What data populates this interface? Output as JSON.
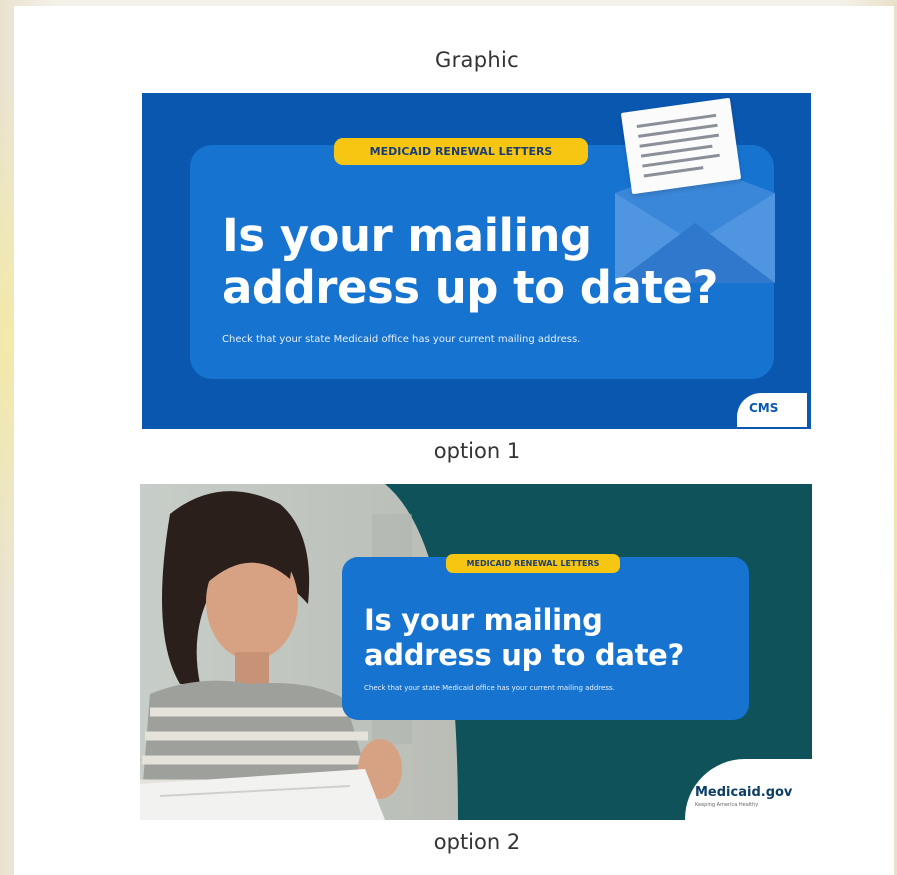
{
  "heading": "Graphic",
  "option1": {
    "caption": "option 1",
    "pill": "MEDICAID RENEWAL LETTERS",
    "headline_line1": "Is your mailing",
    "headline_line2": "address up to date?",
    "subtext": "Check that your state Medicaid office has your current mailing address.",
    "logo": "CMS",
    "colors": {
      "background": "#0a57b0",
      "panel": "#1673cf",
      "pill": "#f6c613"
    },
    "icons": [
      "envelope-letter-icon"
    ]
  },
  "option2": {
    "caption": "option 2",
    "pill": "MEDICAID RENEWAL LETTERS",
    "headline_line1": "Is your mailing",
    "headline_line2": "address up to date?",
    "subtext": "Check that your state Medicaid office has your current mailing address.",
    "logo": "Medicaid.gov",
    "logo_tagline": "Keeping America Healthy",
    "colors": {
      "background": "#0f525a",
      "panel": "#1673cf",
      "pill": "#f6c613"
    }
  }
}
